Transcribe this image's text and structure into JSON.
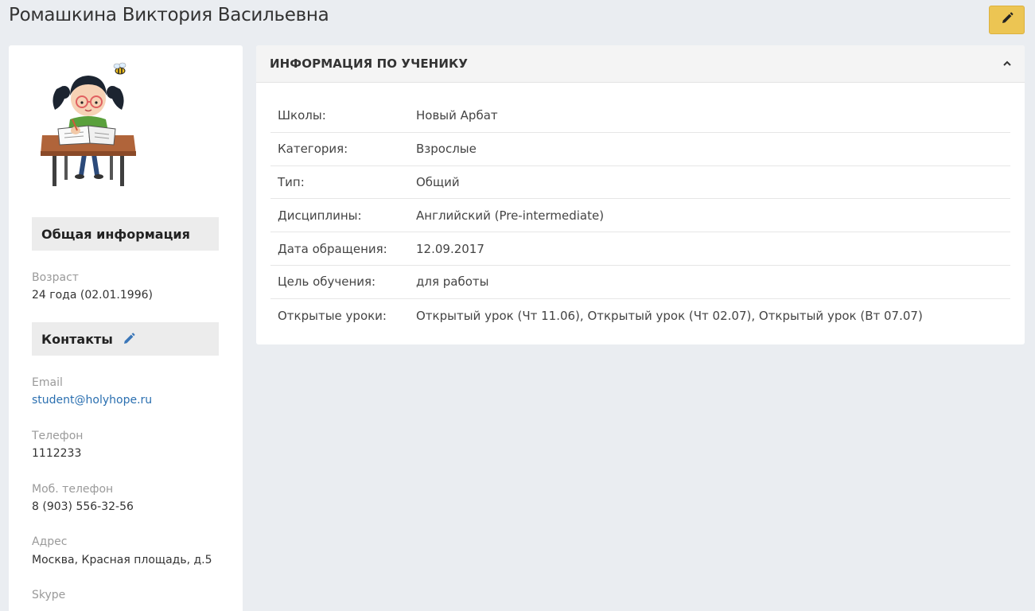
{
  "header": {
    "title": "Ромашкина Виктория Васильевна",
    "edit_icon": "pencil-icon",
    "edit_color": "#ecc553"
  },
  "profile": {
    "general_section": "Общая информация",
    "age_label": "Возраст",
    "age_value": "24 года (02.01.1996)",
    "contacts_section": "Контакты",
    "email_label": "Email",
    "email_value": "student@holyhope.ru",
    "phone_label": "Телефон",
    "phone_value": "1112233",
    "mobile_label": "Моб. телефон",
    "mobile_value": "8 (903) 556-32-56",
    "address_label": "Адрес",
    "address_value": "Москва, Красная площадь, д.5",
    "skype_label": "Skype"
  },
  "info": {
    "title": "ИНФОРМАЦИЯ ПО УЧЕНИКУ",
    "rows": [
      {
        "key": "Школы:",
        "value": "Новый Арбат"
      },
      {
        "key": "Категория:",
        "value": "Взрослые"
      },
      {
        "key": "Тип:",
        "value": "Общий"
      },
      {
        "key": "Дисциплины:",
        "value": "Английский (Pre-intermediate)"
      },
      {
        "key": "Дата обращения:",
        "value": "12.09.2017"
      },
      {
        "key": "Цель обучения:",
        "value": "для работы"
      },
      {
        "key": "Открытые уроки:",
        "value": "Открытый урок (Чт 11.06), Открытый урок (Чт 02.07), Открытый урок (Вт 07.07)"
      }
    ]
  },
  "colors": {
    "background": "#eaedf1",
    "link": "#2a6fb0",
    "accent": "#ecc553"
  }
}
